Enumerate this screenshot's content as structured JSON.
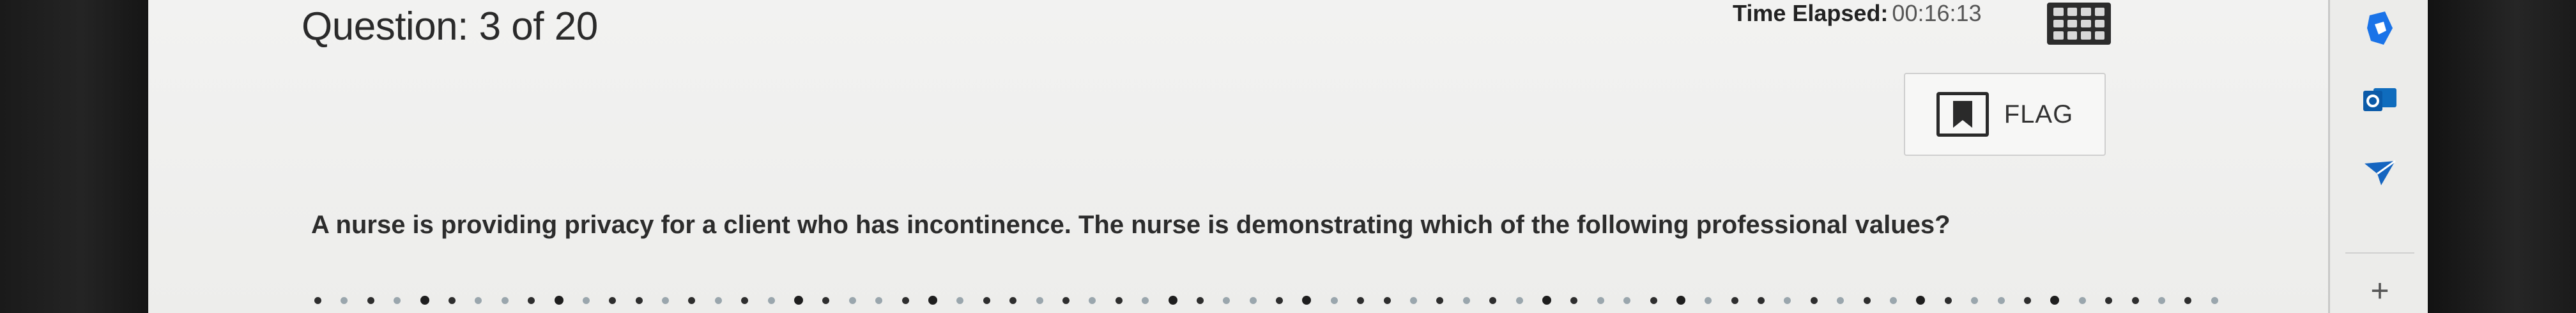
{
  "exam": {
    "question_counter": "Question: 3 of 20",
    "timer": {
      "label": "Time Elapsed:",
      "value": "00:16:13"
    },
    "calculator": {
      "icon": "calculator-icon"
    },
    "flag_button": {
      "label": "FLAG",
      "icon": "bookmark-icon"
    },
    "question_stem": "A nurse is providing privacy for a client who has incontinence. The nurse is demonstrating which of the following professional values?"
  },
  "sidebar_toolbar": {
    "icons": [
      "drive-icon",
      "outlook-icon",
      "send-icon",
      "add-icon"
    ],
    "add_label": "+"
  },
  "colors": {
    "page_background": "#efefed",
    "text_primary": "#2a2a2a",
    "drive_blue": "#1a73e8",
    "outlook_blue": "#0f6cbd"
  }
}
